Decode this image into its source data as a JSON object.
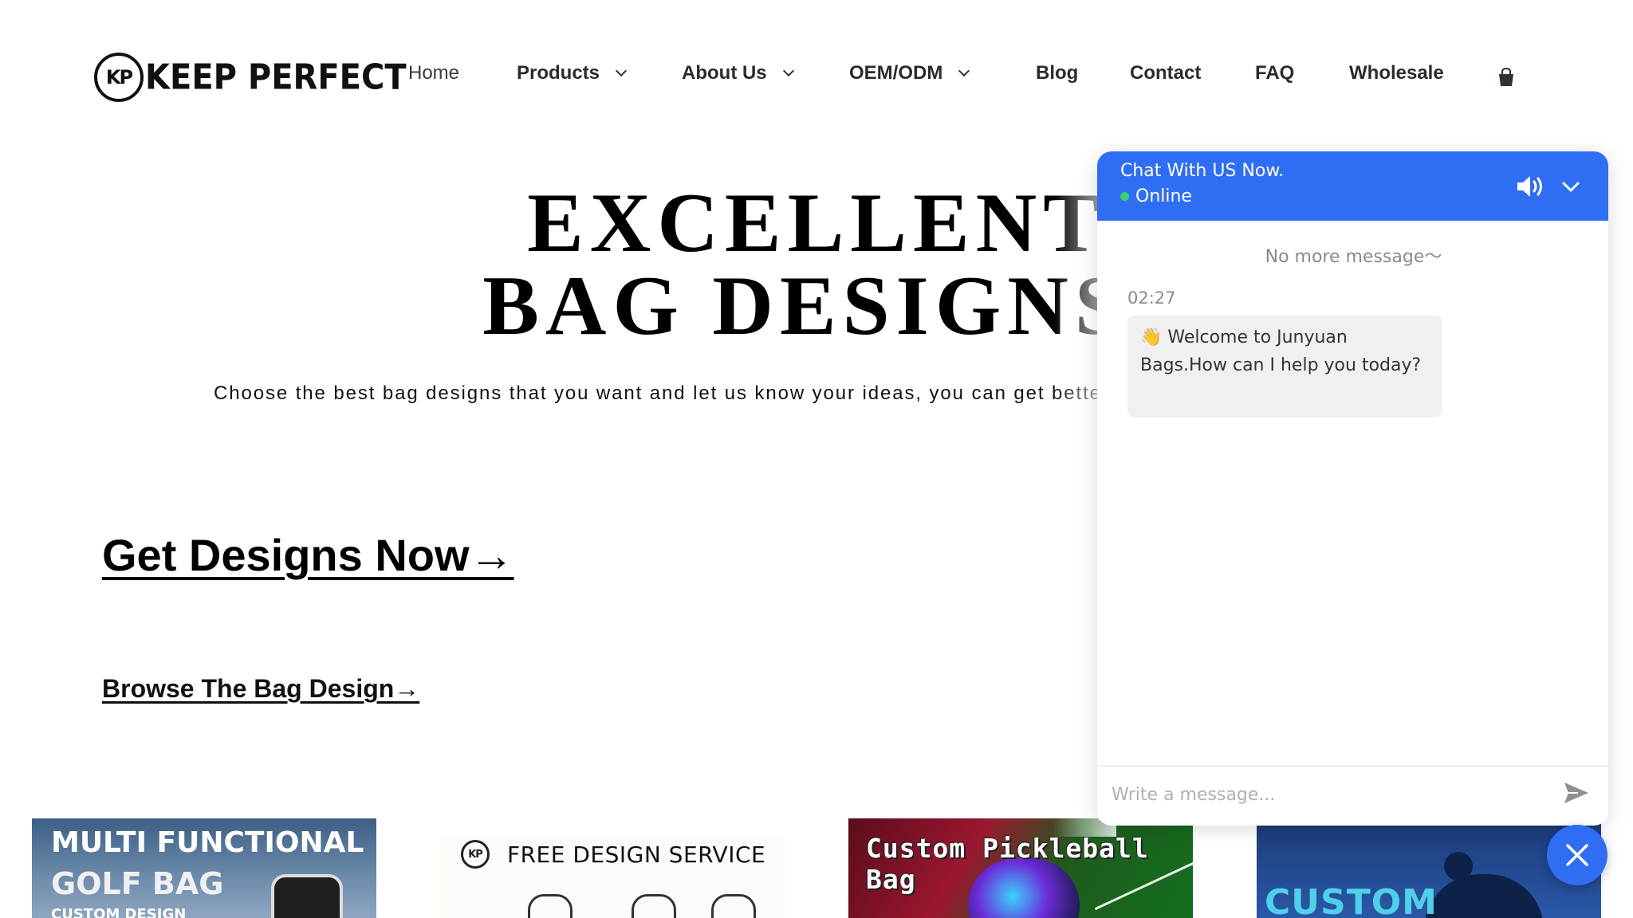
{
  "header": {
    "logo_mark": "KP",
    "logo_text": "KEEP PERFECT",
    "nav": [
      {
        "label": "Home"
      },
      {
        "label": "Products"
      },
      {
        "label": "About Us"
      },
      {
        "label": "OEM/ODM"
      },
      {
        "label": "Blog"
      },
      {
        "label": "Contact"
      },
      {
        "label": "FAQ"
      },
      {
        "label": "Wholesale"
      }
    ],
    "cart_icon": "shopping-bag-icon"
  },
  "hero": {
    "title_line1": "EXCELLENT",
    "title_line2": "BAG DESIGNS",
    "subtitle": "Choose the best bag designs that you want and let us know your ideas, you can get better and better design for yourself.",
    "cta_primary": "Get Designs Now→",
    "cta_secondary": "Browse The Bag Design→"
  },
  "cards": [
    {
      "title_line1": "MULTI FUNCTIONAL",
      "title_line2": "GOLF BAG",
      "title_line3": "CUSTOM DESIGN"
    },
    {
      "mark": "KP",
      "title": "FREE DESIGN SERVICE"
    },
    {
      "title": "Custom Pickleball Bag"
    },
    {
      "title": "CUSTOM"
    }
  ],
  "chat": {
    "title": "Chat With US Now.",
    "status": "Online",
    "status_color": "#35d46b",
    "accent_color": "#2f6ef2",
    "no_more": "No more message～",
    "message_time": "02:27",
    "message_text": "👋 Welcome to Junyuan Bags.How can I help you today?",
    "input_placeholder": "Write a message...",
    "icons": [
      "speaker-icon",
      "chevron-down-icon",
      "send-icon",
      "close-icon"
    ]
  }
}
